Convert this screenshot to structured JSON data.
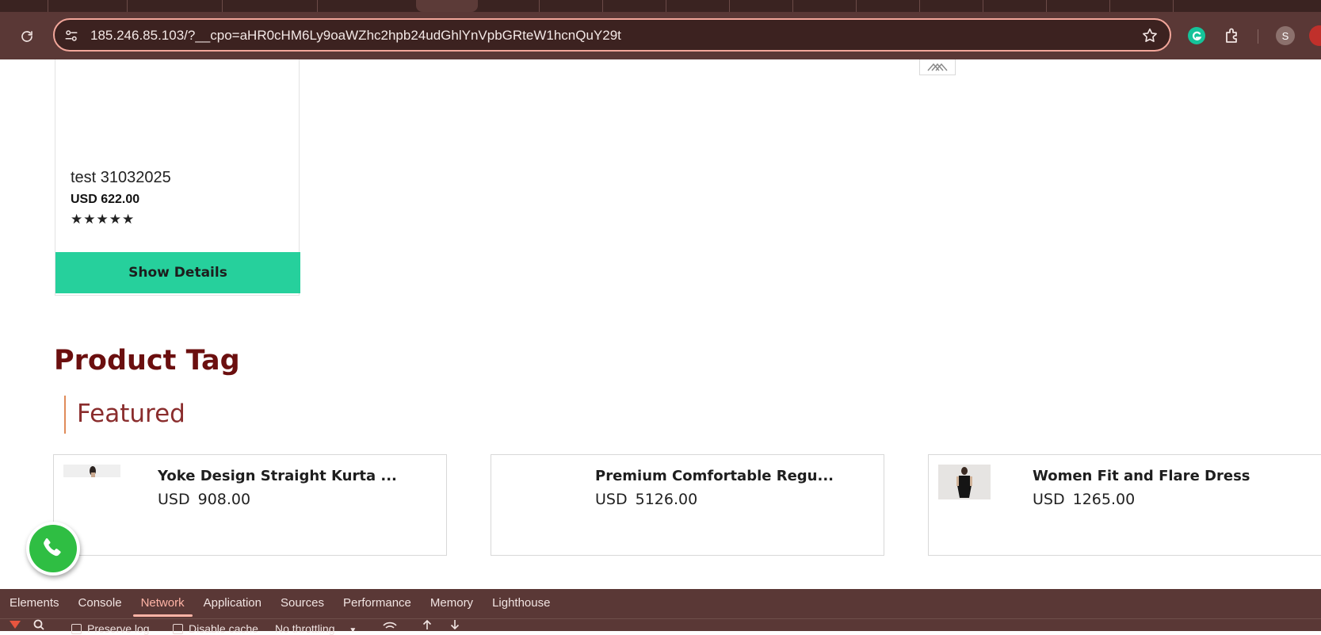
{
  "browser": {
    "url": "185.246.85.103/?__cpo=aHR0cHM6Ly9oaWZhc2hpb24udGhlYnVpbGRteW1hcnQuY29t",
    "profile_initial": "S"
  },
  "product_card": {
    "name": "test 31032025",
    "price": "USD 622.00",
    "stars": "★★★★★",
    "details_label": "Show Details"
  },
  "section": {
    "title": "Product Tag",
    "subheading": "Featured"
  },
  "featured": [
    {
      "title": "Yoke Design Straight Kurta ...",
      "currency": "USD",
      "amount": "908.00"
    },
    {
      "title": "Premium Comfortable Regu...",
      "currency": "USD",
      "amount": "5126.00"
    },
    {
      "title": "Women Fit and Flare Dress",
      "currency": "USD",
      "amount": "1265.00"
    }
  ],
  "devtools": {
    "tabs": [
      "Elements",
      "Console",
      "Network",
      "Application",
      "Sources",
      "Performance",
      "Memory",
      "Lighthouse"
    ],
    "active_tab": "Network",
    "preserve_log": "Preserve log",
    "disable_cache": "Disable cache",
    "throttling": "No throttling"
  },
  "colors": {
    "chrome_bg": "#5a3836",
    "omnibox_border": "#f2a69a",
    "button_green": "#26d09c",
    "title_maroon": "#6b0f0f",
    "whatsapp_green": "#2fbe43"
  }
}
